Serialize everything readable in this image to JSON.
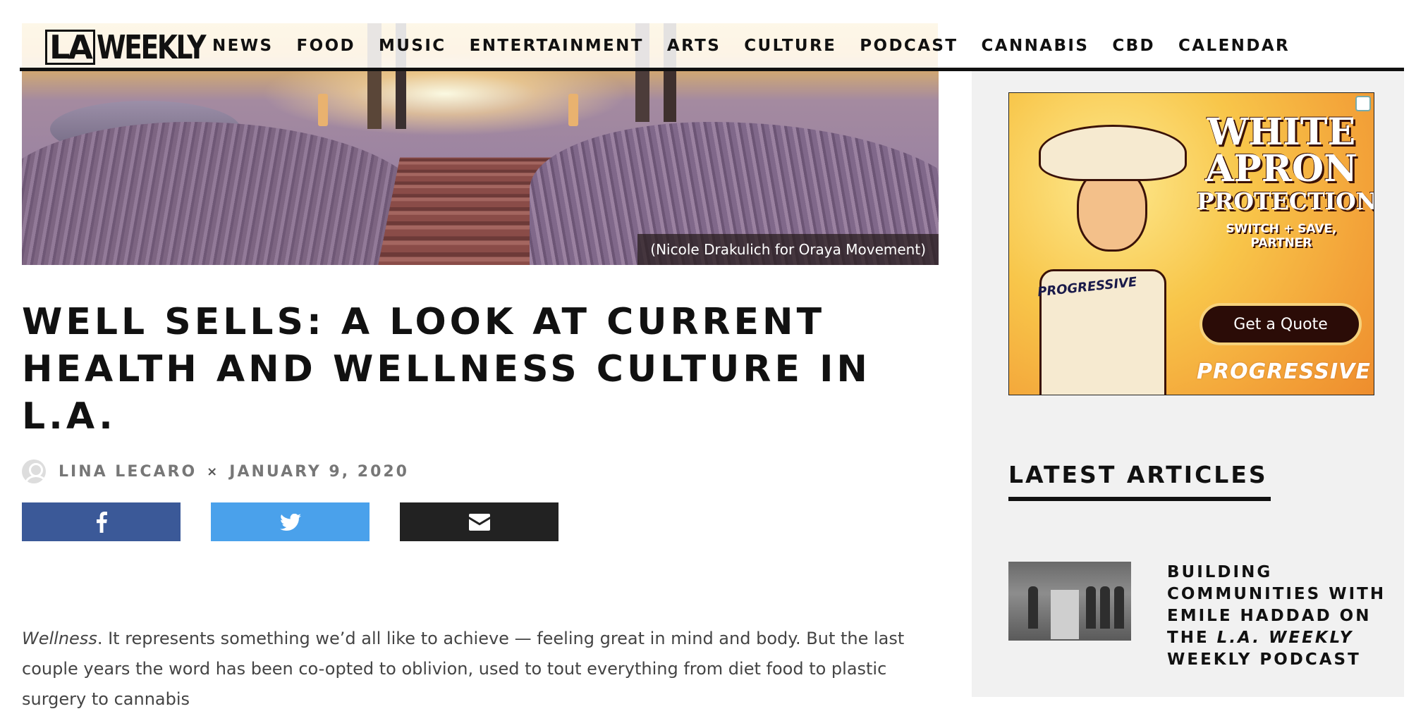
{
  "header": {
    "logo_la": "LA",
    "logo_weekly": "WEEKLY",
    "nav": [
      "NEWS",
      "FOOD",
      "MUSIC",
      "ENTERTAINMENT",
      "ARTS",
      "CULTURE",
      "PODCAST",
      "CANNABIS",
      "CBD",
      "CALENDAR"
    ]
  },
  "hero": {
    "caption": "(Nicole Drakulich for Oraya Movement)"
  },
  "article": {
    "title": "WELL SELLS: A LOOK AT CURRENT HEALTH AND WELLNESS CULTURE IN L.A.",
    "author": "LINA LECARO",
    "separator": "×",
    "date": "JANUARY 9, 2020",
    "share": {
      "facebook_icon": "facebook-icon",
      "twitter_icon": "twitter-icon",
      "email_icon": "email-icon"
    },
    "body_lead_italic": "Wellness",
    "body_rest": ". It represents something we’d all like to achieve — feeling great in mind and body. But the last couple years the word has been co-opted to oblivion, used to tout everything from diet food to plastic surgery to cannabis"
  },
  "sidebar": {
    "ad": {
      "headline_1": "WHITE",
      "headline_2": "APRON",
      "headline_3": "PROTECTION",
      "tagline": "SWITCH + SAVE, PARTNER",
      "cta": "Get a Quote",
      "brand": "PROGRESSIVE",
      "apron_text": "PROGRESSIVE"
    },
    "latest_heading": "LATEST ARTICLES",
    "articles": [
      {
        "title_part1": "BUILDING COMMUNITIES WITH EMILE HADDAD ON THE ",
        "title_italic": "L.A. WEEKLY",
        "title_part2": " WEEKLY PODCAST"
      }
    ]
  }
}
